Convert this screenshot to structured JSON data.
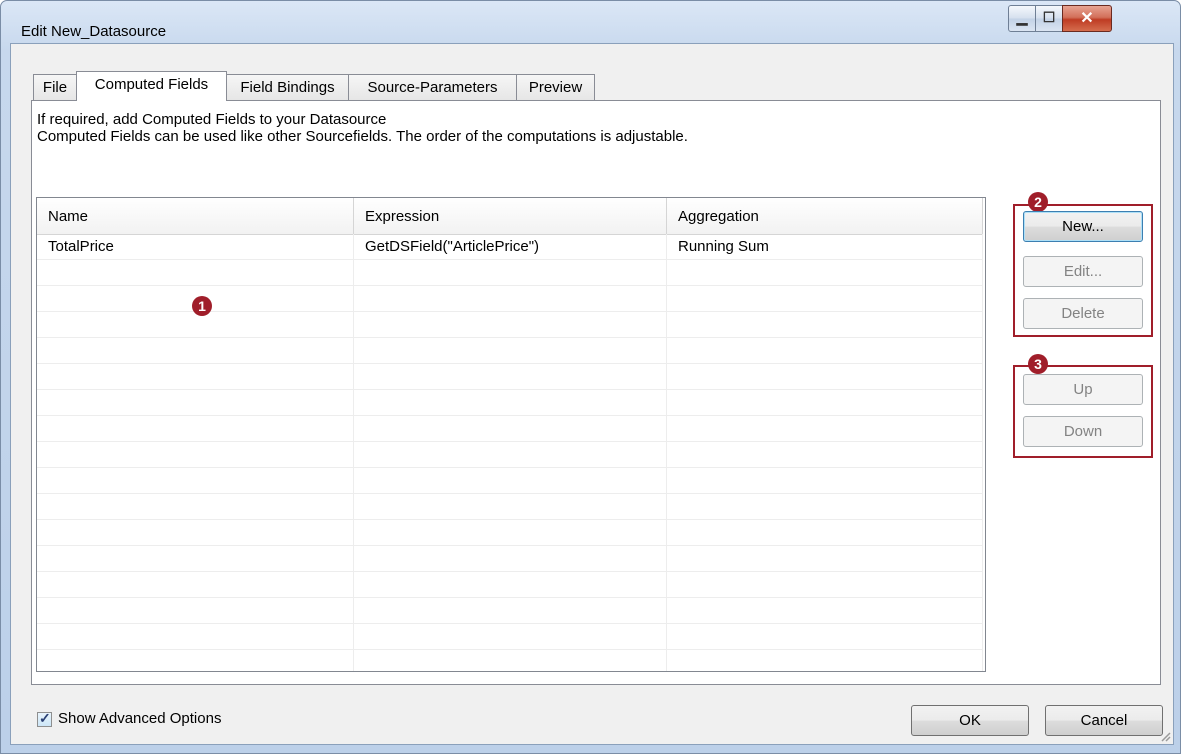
{
  "window": {
    "title": "Edit New_Datasource",
    "minimize_glyph": "▁",
    "maximize_glyph": "☐",
    "close_glyph": "✕"
  },
  "tabs": [
    {
      "label": "File",
      "active": false
    },
    {
      "label": "Computed Fields",
      "active": true
    },
    {
      "label": "Field Bindings",
      "active": false
    },
    {
      "label": "Source-Parameters",
      "active": false
    },
    {
      "label": "Preview",
      "active": false
    }
  ],
  "description": {
    "line1": "If required, add Computed Fields to your Datasource",
    "line2": "Computed Fields can be used like other Sourcefields. The order of the computations is adjustable."
  },
  "table": {
    "columns": [
      "Name",
      "Expression",
      "Aggregation"
    ],
    "rows": [
      {
        "name": "TotalPrice",
        "expression": "GetDSField(\"ArticlePrice\")",
        "aggregation": "Running Sum"
      }
    ]
  },
  "buttons": {
    "new": "New...",
    "edit": "Edit...",
    "delete": "Delete",
    "up": "Up",
    "down": "Down",
    "ok": "OK",
    "cancel": "Cancel"
  },
  "callouts": {
    "badge1": "1",
    "badge2": "2",
    "badge3": "3",
    "color": "#a01e2a"
  },
  "options": {
    "show_advanced_label": "Show Advanced Options",
    "show_advanced_checked": true
  }
}
